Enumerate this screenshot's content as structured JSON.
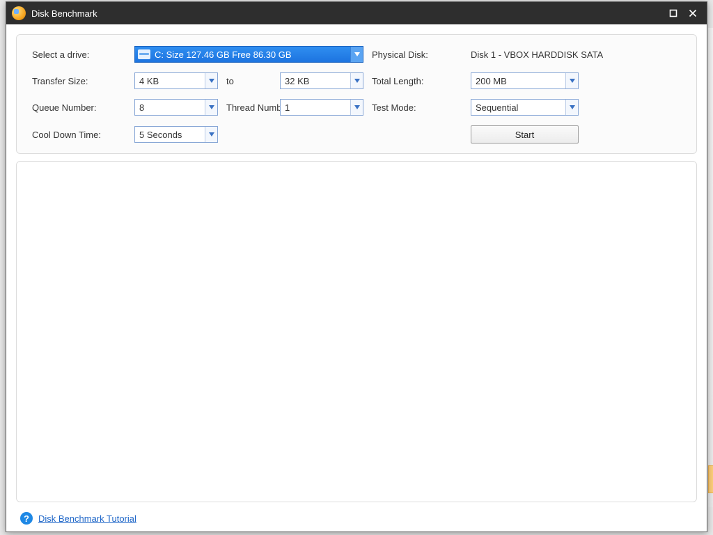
{
  "window": {
    "title": "Disk Benchmark"
  },
  "settings": {
    "drive_label": "Select a drive:",
    "drive_value": "C:  Size 127.46 GB  Free 86.30 GB",
    "physical_disk_label": "Physical Disk:",
    "physical_disk_value": "Disk 1 - VBOX HARDDISK SATA",
    "transfer_size_label": "Transfer Size:",
    "transfer_from": "4 KB",
    "transfer_to_label": "to",
    "transfer_to": "32 KB",
    "total_length_label": "Total Length:",
    "total_length": "200 MB",
    "queue_number_label": "Queue Number:",
    "queue_number": "8",
    "thread_number_label": "Thread Number:",
    "thread_number": "1",
    "test_mode_label": "Test Mode:",
    "test_mode": "Sequential",
    "cooldown_label": "Cool Down Time:",
    "cooldown": "5 Seconds",
    "start_label": "Start"
  },
  "footer": {
    "tutorial_link": "Disk Benchmark Tutorial"
  }
}
